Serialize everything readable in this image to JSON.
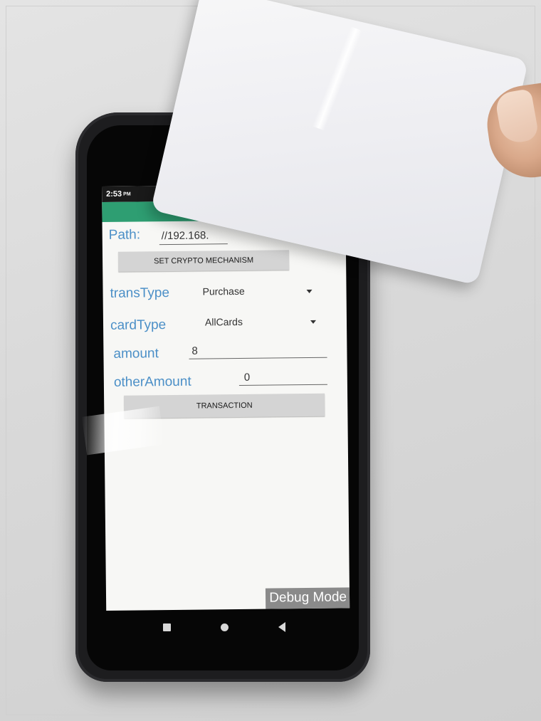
{
  "status_bar": {
    "time": "2:53",
    "ampm": "PM"
  },
  "form": {
    "path_label": "Path:",
    "path_value": "//192.168.",
    "set_crypto_button": "SET CRYPTO MECHANISM",
    "trans_type_label": "transType",
    "trans_type_value": "Purchase",
    "card_type_label": "cardType",
    "card_type_value": "AllCards",
    "amount_label": "amount",
    "amount_value": "8",
    "other_amount_label": "otherAmount",
    "other_amount_value": "0",
    "transaction_button": "TRANSACTION"
  },
  "debug_label": "Debug Mode",
  "colors": {
    "app_bar": "#2e9e72",
    "label_text": "#4b8fc7",
    "button_bg": "#d4d4d4"
  },
  "icons": {
    "nav_recents": "square-icon",
    "nav_home": "circle-icon",
    "nav_back": "triangle-back-icon"
  }
}
